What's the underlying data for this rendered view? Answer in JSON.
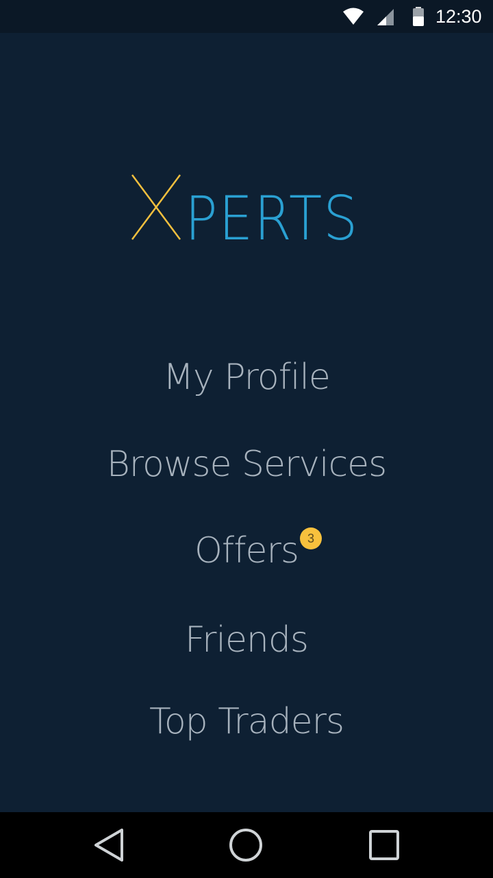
{
  "status_bar": {
    "time": "12:30",
    "icons": [
      "wifi-icon",
      "cell-signal-icon",
      "battery-icon"
    ]
  },
  "logo": {
    "text": "XPERTS",
    "first_letter": "X",
    "rest": "PERTS",
    "colors": {
      "first_letter": "#f2bf3e",
      "rest": "#2aa0d2"
    }
  },
  "menu": {
    "items": [
      {
        "label": "My Profile"
      },
      {
        "label": "Browse Services"
      },
      {
        "label": "Offers",
        "badge": "3"
      },
      {
        "label": "Friends"
      },
      {
        "label": "Top Traders"
      }
    ]
  },
  "nav_bar": {
    "icons": [
      "back-icon",
      "home-icon",
      "recents-icon"
    ]
  },
  "colors": {
    "background": "#0e2033",
    "status_bar": "#0b1826",
    "menu_text": "#a7b2bd",
    "badge": "#f8c13d",
    "nav_bar": "#000000"
  }
}
